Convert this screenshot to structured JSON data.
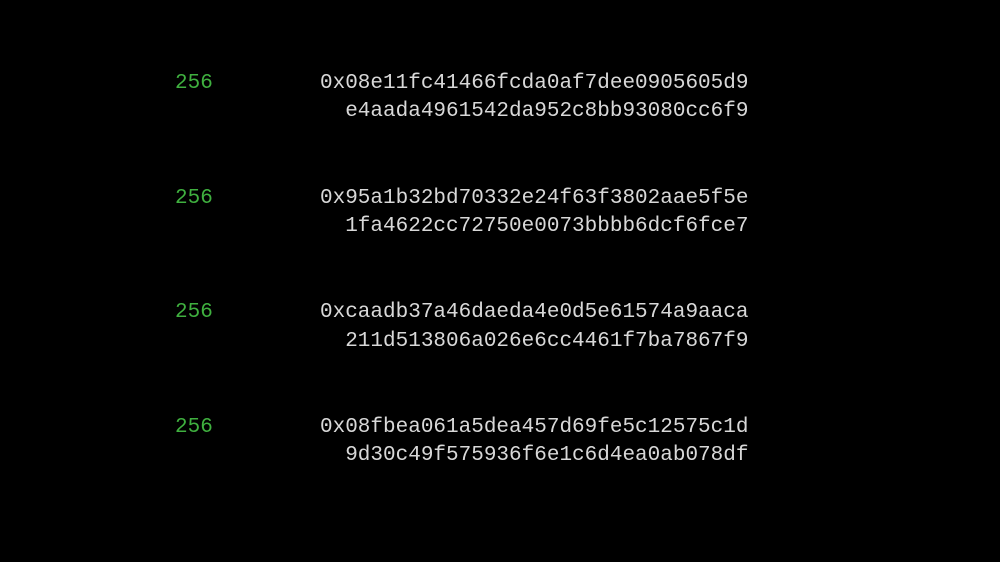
{
  "entries": [
    {
      "bits": "256",
      "hash_line1": "0x08e11fc41466fcda0af7dee0905605d9",
      "hash_line2": "  e4aada4961542da952c8bb93080cc6f9"
    },
    {
      "bits": "256",
      "hash_line1": "0x95a1b32bd70332e24f63f3802aae5f5e",
      "hash_line2": "  1fa4622cc72750e0073bbbb6dcf6fce7"
    },
    {
      "bits": "256",
      "hash_line1": "0xcaadb37a46daeda4e0d5e61574a9aaca",
      "hash_line2": "  211d513806a026e6cc4461f7ba7867f9"
    },
    {
      "bits": "256",
      "hash_line1": "0x08fbea061a5dea457d69fe5c12575c1d",
      "hash_line2": "  9d30c49f575936f6e1c6d4ea0ab078df"
    }
  ]
}
